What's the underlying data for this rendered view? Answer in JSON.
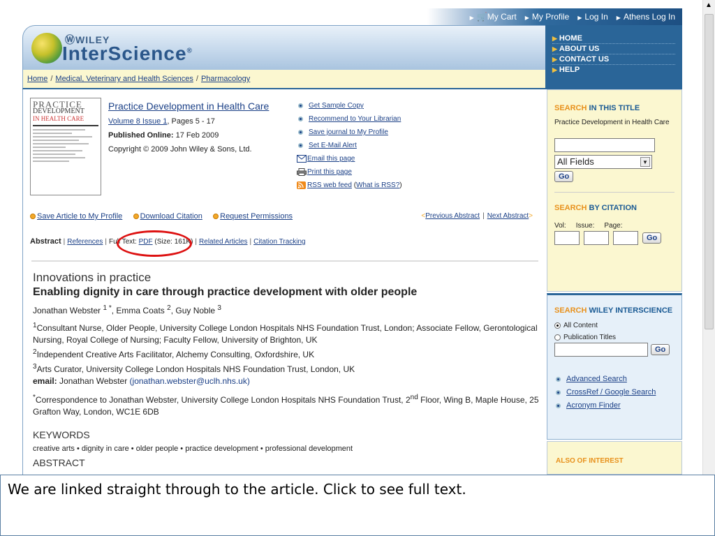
{
  "topnav": {
    "items": [
      "My Cart",
      "My Profile",
      "Log In",
      "Athens Log In"
    ]
  },
  "brand": {
    "wiley": "WILEY",
    "name": "InterScience"
  },
  "rightnav": {
    "items": [
      "HOME",
      "ABOUT US",
      "CONTACT US",
      "HELP"
    ]
  },
  "breadcrumb": {
    "items": [
      "Home",
      "Medical, Veterinary and Health Sciences",
      "Pharmacology"
    ],
    "sep": "/"
  },
  "cover": {
    "line1": "PRACTICE",
    "line2": "DEVELOPMENT",
    "line3": "IN HEALTH CARE"
  },
  "journal": {
    "title": "Practice Development in Health Care",
    "volume": "Volume 8 Issue 1",
    "pages": ", Pages 5 - 17",
    "published_label": "Published Online:",
    "published_date": "17 Feb 2009",
    "copyright": "Copyright © 2009 John Wiley & Sons, Ltd."
  },
  "journal_links": {
    "sample": "Get Sample Copy",
    "recommend": "Recommend to Your Librarian",
    "save": "Save journal to My Profile",
    "alert": "Set E-Mail Alert",
    "email": "Email this page",
    "print": "Print this page",
    "rss": "RSS web feed",
    "rss_what": "What is RSS?"
  },
  "article_actions": {
    "save": "Save Article to My Profile",
    "download": "Download Citation",
    "permissions": "Request Permissions",
    "prev": "Previous Abstract",
    "next": "Next Abstract"
  },
  "tabs": {
    "abstract": "Abstract",
    "references": "References",
    "fulltext_label": "Full Text:",
    "pdf": "PDF",
    "size": "(Size: 161K)",
    "related": "Related Articles",
    "tracking": "Citation Tracking"
  },
  "article": {
    "category": "Innovations in practice",
    "title": "Enabling dignity in care through practice development with older people",
    "authors": [
      {
        "name": "Jonathan Webster",
        "sup": "1 *"
      },
      {
        "name": "Emma Coats",
        "sup": "2"
      },
      {
        "name": "Guy Noble",
        "sup": "3"
      }
    ],
    "affiliations": [
      {
        "sup": "1",
        "text": "Consultant Nurse, Older People, University College London Hospitals NHS Foundation Trust, London; Associate Fellow, Gerontological Nursing, Royal College of Nursing; Faculty Fellow, University of Brighton, UK"
      },
      {
        "sup": "2",
        "text": "Independent Creative Arts Facilitator, Alchemy Consulting, Oxfordshire, UK"
      },
      {
        "sup": "3",
        "text": "Arts Curator, University College London Hospitals NHS Foundation Trust, London, UK"
      }
    ],
    "email_label": "email:",
    "email_name": "Jonathan Webster",
    "email_addr": "(jonathan.webster@uclh.nhs.uk)",
    "correspondence_a": "Correspondence to Jonathan Webster, University College London Hospitals NHS Foundation Trust, 2",
    "correspondence_sup": "nd",
    "correspondence_b": " Floor, Wing B, Maple House, 25 Grafton Way, London, WC1E 6DB",
    "keywords_heading": "KEYWORDS",
    "keywords": "creative arts • dignity in care • older people • practice development • professional development",
    "abstract_heading": "ABSTRACT"
  },
  "search_title": {
    "label_a": "SEARCH",
    "label_b": "IN THIS TITLE",
    "journal": "Practice Development in Health Care",
    "field_value": "",
    "select_value": "All Fields",
    "go": "Go"
  },
  "search_citation": {
    "label_a": "SEARCH",
    "label_b": "BY CITATION",
    "vol": "Vol:",
    "issue": "Issue:",
    "page": "Page:",
    "go": "Go"
  },
  "search_wiley": {
    "label_a": "SEARCH",
    "label_b": "WILEY INTERSCIENCE",
    "opt1": "All Content",
    "opt2": "Publication Titles",
    "go": "Go",
    "links": [
      "Advanced Search",
      "CrossRef / Google Search",
      "Acronym Finder"
    ]
  },
  "also_interest": "ALSO OF INTEREST",
  "caption": "We are linked straight through to the article. Click to see full text."
}
